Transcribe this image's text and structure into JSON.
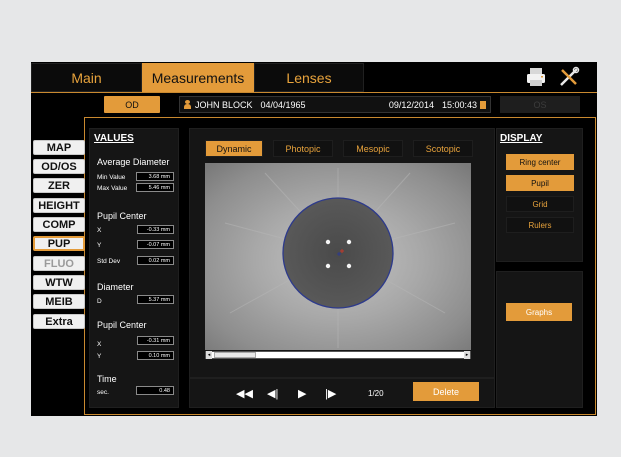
{
  "tabs": [
    "Main",
    "Measurements",
    "Lenses"
  ],
  "icons": {
    "printer": "printer-icon",
    "tools": "tools-icon"
  },
  "patient": {
    "od_label": "OD",
    "os_label": "OS",
    "name": "JOHN  BLOCK",
    "dob": "04/04/1965",
    "exam_date": "09/12/2014",
    "exam_time": "15:00:43"
  },
  "left_menu": [
    "MAP",
    "OD/OS",
    "ZER",
    "HEIGHT",
    "COMP",
    "PUP",
    "FLUO",
    "WTW",
    "MEIB",
    "Extra"
  ],
  "values": {
    "title": "VALUES",
    "average_diameter": {
      "label": "Average Diameter",
      "min_label": "Min Value",
      "min_value": "3.68 mm",
      "max_label": "Max Value",
      "max_value": "5.46 mm"
    },
    "pupil_center": {
      "label": "Pupil Center",
      "x_label": "X",
      "x_value": "-0.33 mm",
      "y_label": "Y",
      "y_value": "-0.07 mm",
      "std_label": "Std Dev",
      "std_value": "0.02 mm"
    },
    "diameter": {
      "label": "Diameter",
      "d_label": "D",
      "d_value": "5.37 mm"
    },
    "pupil_center2": {
      "label": "Pupil Center",
      "x_label": "X",
      "x_value": "-0.31 mm",
      "y_label": "Y",
      "y_value": "0.10 mm"
    },
    "time": {
      "label": "Time",
      "sec_label": "sec.",
      "sec_value": "0.48"
    }
  },
  "light_tabs": [
    "Dynamic",
    "Photopic",
    "Mesopic",
    "Scotopic"
  ],
  "display": {
    "title": "DISPLAY",
    "options": [
      "Ring center",
      "Pupil",
      "Grid",
      "Rulers"
    ],
    "graphs_label": "Graphs"
  },
  "playback": {
    "first": "◀◀",
    "prev": "◀|",
    "play": "▶",
    "next": "|▶",
    "counter": "1/20",
    "delete_label": "Delete"
  },
  "scrollbar": {
    "left_arrow": "◂",
    "right_arrow": "▸"
  },
  "colors": {
    "accent": "#e39b3a",
    "background": "#000000",
    "panel": "#151515"
  }
}
